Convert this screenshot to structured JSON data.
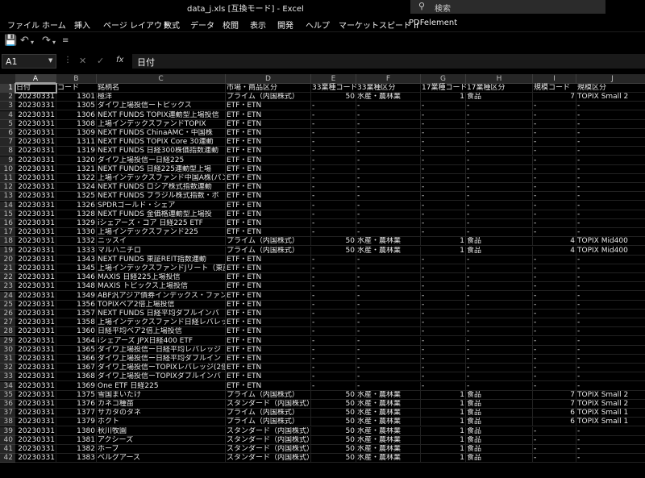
{
  "app": {
    "title": "data_j.xls [互換モード] - Excel"
  },
  "search": {
    "icon": "search-icon",
    "label": "検索"
  },
  "ribbon_tabs": [
    "ファイル",
    "ホーム",
    "挿入",
    "ページ レイアウト",
    "数式",
    "データ",
    "校閲",
    "表示",
    "開発",
    "ヘルプ",
    "マーケットスピード II",
    "PDFelement"
  ],
  "formula_bar": {
    "name_box": "A1",
    "value": "日付",
    "fx": "fx"
  },
  "columns": [
    "A",
    "B",
    "C",
    "D",
    "E",
    "F",
    "G",
    "H",
    "I",
    "J"
  ],
  "headers": [
    "日付",
    "コード",
    "銘柄名",
    "市場・商品区分",
    "33業種コード",
    "33業種区分",
    "17業種コード",
    "17業種区分",
    "規模コード",
    "規模区分"
  ],
  "rows": [
    [
      "20230331",
      "1301",
      "極洋",
      "プライム（内国株式）",
      "50",
      "水産・農林業",
      "1",
      "食品",
      "7",
      "TOPIX Small 2"
    ],
    [
      "20230331",
      "1305",
      "ダイワ上場投信ートピックス",
      "ETF・ETN",
      "-",
      "-",
      "-",
      "-",
      "-",
      "-"
    ],
    [
      "20230331",
      "1306",
      "NEXT FUNDS TOPIX連動型上場投信",
      "ETF・ETN",
      "-",
      "-",
      "-",
      "-",
      "-",
      "-"
    ],
    [
      "20230331",
      "1308",
      "上場インデックスファンドTOPIX",
      "ETF・ETN",
      "-",
      "-",
      "-",
      "-",
      "-",
      "-"
    ],
    [
      "20230331",
      "1309",
      "NEXT FUNDS ChinaAMC・中国株",
      "ETF・ETN",
      "-",
      "-",
      "-",
      "-",
      "-",
      "-"
    ],
    [
      "20230331",
      "1311",
      "NEXT FUNDS TOPIX Core 30連動",
      "ETF・ETN",
      "-",
      "-",
      "-",
      "-",
      "-",
      "-"
    ],
    [
      "20230331",
      "1319",
      "NEXT FUNDS 日経300株価指数連動",
      "ETF・ETN",
      "-",
      "-",
      "-",
      "-",
      "-",
      "-"
    ],
    [
      "20230331",
      "1320",
      "ダイワ上場投信ー日経225",
      "ETF・ETN",
      "-",
      "-",
      "-",
      "-",
      "-",
      "-"
    ],
    [
      "20230331",
      "1321",
      "NEXT FUNDS 日経225連動型上場",
      "ETF・ETN",
      "-",
      "-",
      "-",
      "-",
      "-",
      "-"
    ],
    [
      "20230331",
      "1322",
      "上場インデックスファンド中国A株(パン",
      "ETF・ETN",
      "-",
      "-",
      "-",
      "-",
      "-",
      "-"
    ],
    [
      "20230331",
      "1324",
      "NEXT FUNDS ロシア株式指数連動",
      "ETF・ETN",
      "-",
      "-",
      "-",
      "-",
      "-",
      "-"
    ],
    [
      "20230331",
      "1325",
      "NEXT FUNDS ブラジル株式指数・ボ",
      "ETF・ETN",
      "-",
      "-",
      "-",
      "-",
      "-",
      "-"
    ],
    [
      "20230331",
      "1326",
      "SPDRゴールド・シェア",
      "ETF・ETN",
      "-",
      "-",
      "-",
      "-",
      "-",
      "-"
    ],
    [
      "20230331",
      "1328",
      "NEXT FUNDS 金価格連動型上場投",
      "ETF・ETN",
      "-",
      "-",
      "-",
      "-",
      "-",
      "-"
    ],
    [
      "20230331",
      "1329",
      "iシェアーズ・コア 日経225 ETF",
      "ETF・ETN",
      "-",
      "-",
      "-",
      "-",
      "-",
      "-"
    ],
    [
      "20230331",
      "1330",
      "上場インデックスファンド225",
      "ETF・ETN",
      "-",
      "-",
      "-",
      "-",
      "-",
      "-"
    ],
    [
      "20230331",
      "1332",
      "ニッスイ",
      "プライム（内国株式）",
      "50",
      "水産・農林業",
      "1",
      "食品",
      "4",
      "TOPIX Mid400"
    ],
    [
      "20230331",
      "1333",
      "マルハニチロ",
      "プライム（内国株式）",
      "50",
      "水産・農林業",
      "1",
      "食品",
      "4",
      "TOPIX Mid400"
    ],
    [
      "20230331",
      "1343",
      "NEXT FUNDS 東証REIT指数連動",
      "ETF・ETN",
      "-",
      "-",
      "-",
      "-",
      "-",
      "-"
    ],
    [
      "20230331",
      "1345",
      "上場インデックスファンドJリート（東証R",
      "ETF・ETN",
      "-",
      "-",
      "-",
      "-",
      "-",
      "-"
    ],
    [
      "20230331",
      "1346",
      "MAXIS 日経225上場投信",
      "ETF・ETN",
      "-",
      "-",
      "-",
      "-",
      "-",
      "-"
    ],
    [
      "20230331",
      "1348",
      "MAXIS トピックス上場投信",
      "ETF・ETN",
      "-",
      "-",
      "-",
      "-",
      "-",
      "-"
    ],
    [
      "20230331",
      "1349",
      "ABF汎アジア債券インデックス・ファンド",
      "ETF・ETN",
      "-",
      "-",
      "-",
      "-",
      "-",
      "-"
    ],
    [
      "20230331",
      "1356",
      "TOPIXベア2倍上場投信",
      "ETF・ETN",
      "-",
      "-",
      "-",
      "-",
      "-",
      "-"
    ],
    [
      "20230331",
      "1357",
      "NEXT FUNDS 日経平均ダブルインバ",
      "ETF・ETN",
      "-",
      "-",
      "-",
      "-",
      "-",
      "-"
    ],
    [
      "20230331",
      "1358",
      "上場インデックスファンド日経レバレッジ",
      "ETF・ETN",
      "-",
      "-",
      "-",
      "-",
      "-",
      "-"
    ],
    [
      "20230331",
      "1360",
      "日経平均ベア2倍上場投信",
      "ETF・ETN",
      "-",
      "-",
      "-",
      "-",
      "-",
      "-"
    ],
    [
      "20230331",
      "1364",
      "iシェアーズ JPX日経400 ETF",
      "ETF・ETN",
      "-",
      "-",
      "-",
      "-",
      "-",
      "-"
    ],
    [
      "20230331",
      "1365",
      "ダイワ上場投信ー日経平均レバレッジ",
      "ETF・ETN",
      "-",
      "-",
      "-",
      "-",
      "-",
      "-"
    ],
    [
      "20230331",
      "1366",
      "ダイワ上場投信ー日経平均ダブルイン",
      "ETF・ETN",
      "-",
      "-",
      "-",
      "-",
      "-",
      "-"
    ],
    [
      "20230331",
      "1367",
      "ダイワ上場投信ーTOPIXレバレッジ(2倍",
      "ETF・ETN",
      "-",
      "-",
      "-",
      "-",
      "-",
      "-"
    ],
    [
      "20230331",
      "1368",
      "ダイワ上場投信ーTOPIXダブルインバ",
      "ETF・ETN",
      "-",
      "-",
      "-",
      "-",
      "-",
      "-"
    ],
    [
      "20230331",
      "1369",
      "One ETF 日経225",
      "ETF・ETN",
      "-",
      "-",
      "-",
      "-",
      "-",
      "-"
    ],
    [
      "20230331",
      "1375",
      "雪国まいたけ",
      "プライム（内国株式）",
      "50",
      "水産・農林業",
      "1",
      "食品",
      "7",
      "TOPIX Small 2"
    ],
    [
      "20230331",
      "1376",
      "カネコ種苗",
      "スタンダード（内国株式）",
      "50",
      "水産・農林業",
      "1",
      "食品",
      "7",
      "TOPIX Small 2"
    ],
    [
      "20230331",
      "1377",
      "サカタのタネ",
      "プライム（内国株式）",
      "50",
      "水産・農林業",
      "1",
      "食品",
      "6",
      "TOPIX Small 1"
    ],
    [
      "20230331",
      "1379",
      "ホクト",
      "プライム（内国株式）",
      "50",
      "水産・農林業",
      "1",
      "食品",
      "6",
      "TOPIX Small 1"
    ],
    [
      "20230331",
      "1380",
      "秋川牧園",
      "スタンダード（内国株式）",
      "50",
      "水産・農林業",
      "1",
      "食品",
      "-",
      "-"
    ],
    [
      "20230331",
      "1381",
      "アクシーズ",
      "スタンダード（内国株式）",
      "50",
      "水産・農林業",
      "1",
      "食品",
      "-",
      "-"
    ],
    [
      "20230331",
      "1382",
      "ホーブ",
      "スタンダード（内国株式）",
      "50",
      "水産・農林業",
      "1",
      "食品",
      "-",
      "-"
    ],
    [
      "20230331",
      "1383",
      "ベルグアース",
      "スタンダード（内国株式）",
      "50",
      "水産・農林業",
      "1",
      "食品",
      "-",
      "-"
    ]
  ]
}
